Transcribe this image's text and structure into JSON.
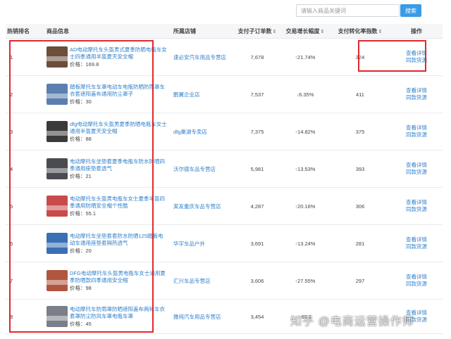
{
  "search": {
    "placeholder": "请输入商品关键词",
    "button_label": "搜索"
  },
  "table": {
    "headers": {
      "rank": "热销排名",
      "product": "商品信息",
      "shop": "所属店铺",
      "sub_orders": "支付子订单数",
      "growth": "交易增长幅度",
      "conversion": "支付转化率指数",
      "ops": "操作"
    },
    "sort_icon": "⇕",
    "price_prefix": "价格：",
    "ops": {
      "detail": "查看详情",
      "similar": "同款货源"
    },
    "rows": [
      {
        "rank": "1",
        "title": "AD电动摩托车头盔男式夏季防晒电瓶车女士四季通用半盔夏天安全帽",
        "price": "169.8",
        "shop": "速必安汽车用品专营店",
        "sub_orders": "7,678",
        "growth_dir": "up",
        "growth": "21.74%",
        "conversion": "324",
        "thumb_color": "#6b4f3a"
      },
      {
        "rank": "2",
        "title": "踏板摩托车车罩电动车电瓶防晒防雨罩车衣套遮阳盖布通用防尘罩子",
        "price": "30",
        "shop": "鹏翼企业店",
        "sub_orders": "7,537",
        "growth_dir": "down",
        "growth": "6.35%",
        "conversion": "411",
        "thumb_color": "#5a7fb0"
      },
      {
        "rank": "3",
        "title": "dfg电动摩托车头盔男夏季防晒电瓶车女士通用半盔夏天安全帽",
        "price": "88",
        "shop": "dfg巢湖专卖店",
        "sub_orders": "7,375",
        "growth_dir": "up",
        "growth": "14.82%",
        "conversion": "375",
        "thumb_color": "#3a3a3a"
      },
      {
        "rank": "4",
        "title": "电动摩托车坐垫套夏季电瓶车防水防晒四季通用座垫套透气",
        "price": "21",
        "shop": "沃尔德车品专营店",
        "sub_orders": "5,981",
        "growth_dir": "up",
        "growth": "13.53%",
        "conversion": "393",
        "thumb_color": "#4a4a52"
      },
      {
        "rank": "5",
        "title": "电动摩托车头盔男电瓶车女士夏季半盔四季通用防晒安全帽个性酷",
        "price": "55.1",
        "shop": "英发重庆车品专营店",
        "sub_orders": "4,287",
        "growth_dir": "up",
        "growth": "20.16%",
        "conversion": "306",
        "thumb_color": "#c94a4a"
      },
      {
        "rank": "6",
        "title": "电动摩托车坐垫套套防水防晒125踏板电动车通用座垫套隔热透气",
        "price": "20",
        "shop": "华宇车品户外",
        "sub_orders": "3,691",
        "growth_dir": "up",
        "growth": "13.24%",
        "conversion": "281",
        "thumb_color": "#3b6fb5"
      },
      {
        "rank": "7",
        "title": "DFG电动摩托车头盔男电瓶车女士通用夏季防晒款四季通用安全帽",
        "price": "98",
        "shop": "汇兴车品专营店",
        "sub_orders": "3,606",
        "growth_dir": "up",
        "growth": "27.55%",
        "conversion": "297",
        "thumb_color": "#b0563f"
      },
      {
        "rank": "8",
        "title": "电动摩托车防雨罩防晒遮阳盖布两轮车衣套罩防尘防风车罩电瓶车罩",
        "price": "45",
        "shop": "雅纯汽车用品专营店",
        "sub_orders": "3,454",
        "growth_dir": "up",
        "growth": "60.1",
        "conversion": "",
        "thumb_color": "#7a7f8a"
      }
    ]
  },
  "watermark": "知乎 @电商运营操作师",
  "colors": {
    "accent": "#3a9be6",
    "link": "#2f7fc9",
    "highlight": "#e0282e",
    "up": "#2aa55b",
    "down": "#e24b4b"
  }
}
